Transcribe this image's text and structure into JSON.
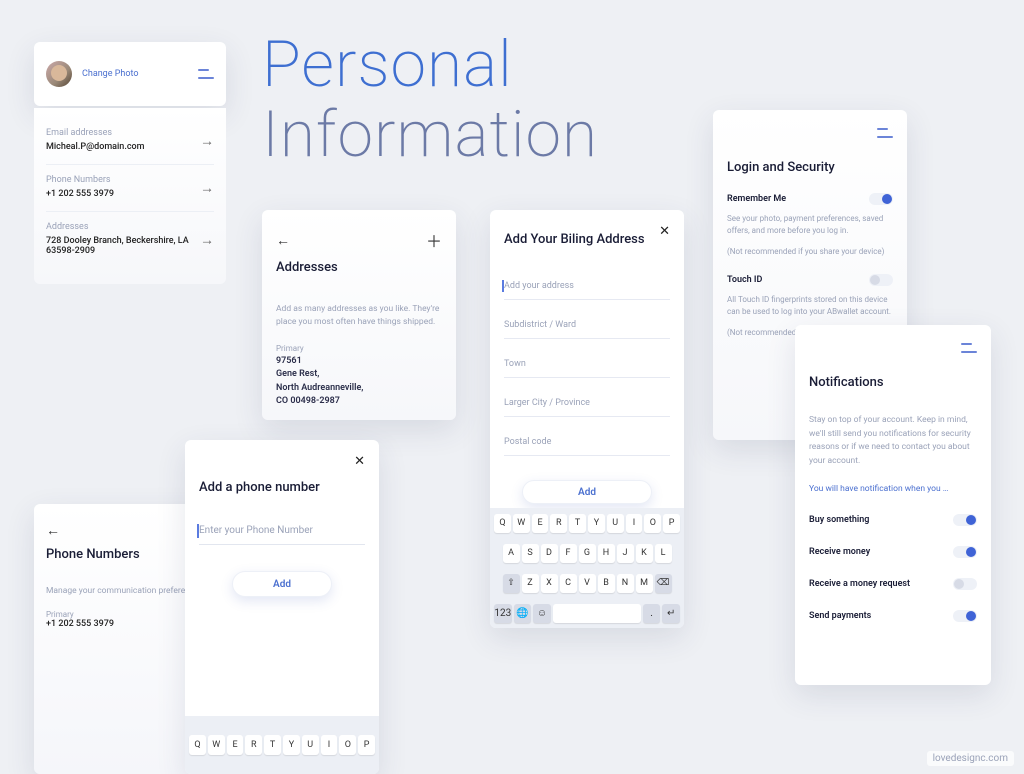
{
  "title_line1": "Personal",
  "title_line2": "Information",
  "profile": {
    "change_photo": "Change Photo",
    "email_lbl": "Email addresses",
    "email_val": "Micheal.P@domain.com",
    "phone_lbl": "Phone Numbers",
    "phone_val": "+1 202 555 3979",
    "addr_lbl": "Addresses",
    "addr_val": "728 Dooley Branch, Beckershire, LA 63598-2909"
  },
  "phones": {
    "title": "Phone Numbers",
    "hint": "Manage your communication preferences",
    "primary_lbl": "Primary",
    "primary_val": "+1 202 555 3979"
  },
  "addresses": {
    "title": "Addresses",
    "hint": "Add as many addresses as you like. They're place you most often have things shipped.",
    "primary_lbl": "Primary",
    "line1": "97561",
    "line2": "Gene Rest,",
    "line3": "North Audreanneville,",
    "line4": "CO 00498-2987"
  },
  "addphone": {
    "title": "Add a phone number",
    "placeholder": "Enter your Phone Number",
    "add_btn": "Add"
  },
  "billing": {
    "title": "Add Your Biling Address",
    "f1": "Add your address",
    "f2": "Subdistrict / Ward",
    "f3": "Town",
    "f4": "Larger City / Province",
    "f5": "Postal code",
    "add_btn": "Add"
  },
  "login": {
    "title": "Login and Security",
    "remember_lbl": "Remember Me",
    "remember_desc": "See your photo, payment preferences, saved offers, and more before you log in.",
    "remember_note": "(Not recommended if you share your device)",
    "touchid_lbl": "Touch ID",
    "touchid_desc": "All Touch ID fingerprints stored on this device can be used to log into your ABwallet account.",
    "touchid_note": "(Not recommended if you share your device)"
  },
  "notif": {
    "title": "Notifications",
    "hint": "Stay on top of your account. Keep in mind, we'll still send you notifications for security reasons or if we need to contact you about your account.",
    "sublink": "You will have notification when you …",
    "r1": "Buy something",
    "r2": "Receive money",
    "r3": "Receive a money request",
    "r4": "Send payments"
  },
  "keyboard": {
    "row1": [
      "Q",
      "W",
      "E",
      "R",
      "T",
      "Y",
      "U",
      "I",
      "O",
      "P"
    ],
    "row2": [
      "A",
      "S",
      "D",
      "F",
      "G",
      "H",
      "J",
      "K",
      "L"
    ],
    "row3": [
      "⇧",
      "Z",
      "X",
      "C",
      "V",
      "B",
      "N",
      "M",
      "⌫"
    ],
    "row4": [
      "123",
      "🌐",
      "☺",
      " ",
      ".",
      "↵"
    ]
  },
  "watermark": "lovedesignc.com"
}
